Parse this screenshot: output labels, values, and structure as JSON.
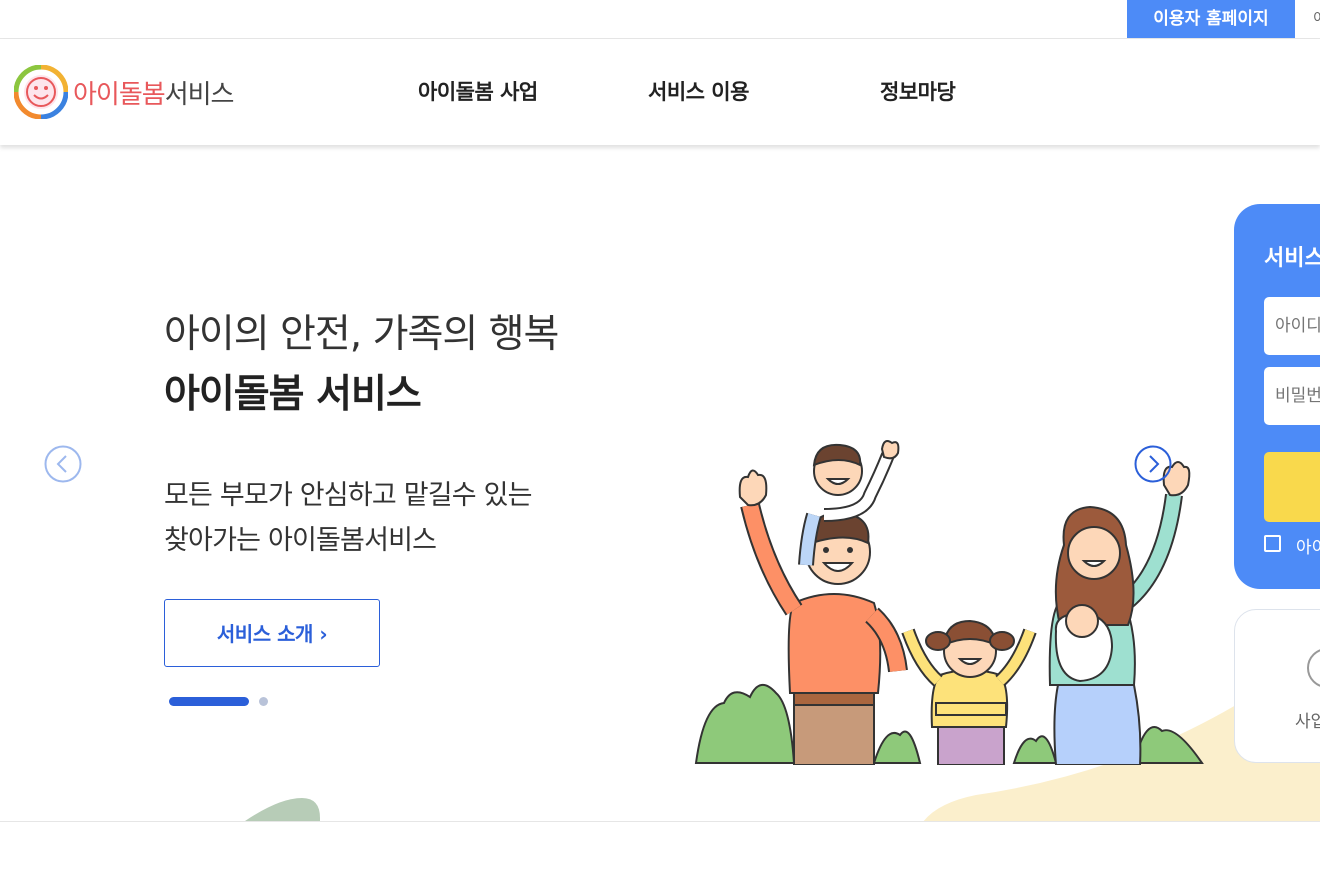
{
  "topbar": {
    "user_home_label": "이용자 홈페이지",
    "next_link_label": "이"
  },
  "header": {
    "logo_accent": "아이돌봄",
    "logo_rest": "서비스",
    "nav": [
      {
        "label": "아이돌봄 사업"
      },
      {
        "label": "서비스 이용"
      },
      {
        "label": "정보마당"
      }
    ]
  },
  "hero": {
    "tagline": "아이의 안전, 가족의 행복",
    "headline": "아이돌봄 서비스",
    "desc_line1": "모든 부모가 안심하고 맡길수 있는",
    "desc_line2": "찾아가는 아이돌봄서비스",
    "intro_button": "서비스 소개 ›",
    "slide_count": 2,
    "active_slide": 1
  },
  "login": {
    "title": "서비스",
    "id_placeholder": "아이디",
    "pw_placeholder": "비밀번",
    "save_label": "아이"
  },
  "biz": {
    "label": "사업"
  },
  "colors": {
    "primary_blue": "#4d8bf7",
    "accent_blue": "#2b5fd9",
    "logo_red": "#e8585b",
    "login_button_yellow": "#f9d94c"
  },
  "icons": [
    "smile-logo-icon",
    "chevron-left-icon",
    "chevron-right-icon",
    "circle-icon"
  ]
}
